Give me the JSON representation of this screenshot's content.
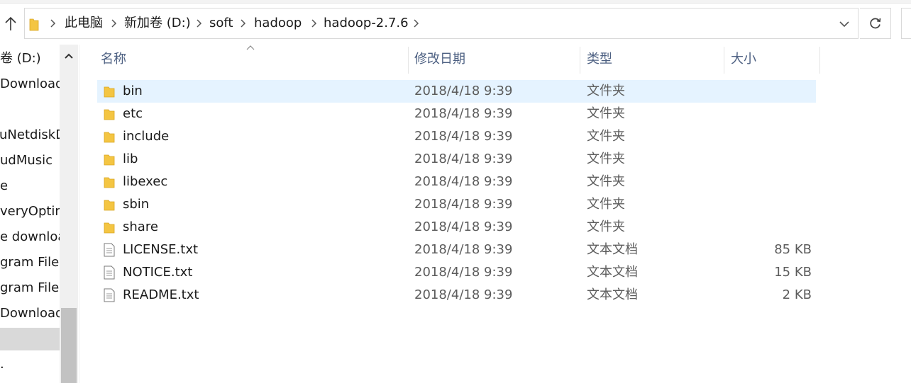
{
  "breadcrumb": [
    "此电脑",
    "新加卷 (D:)",
    "soft",
    "hadoop",
    "hadoop-2.7.6"
  ],
  "nav_items": [
    {
      "label": "卷 (D:)"
    },
    {
      "label": "Download"
    },
    {
      "label": ""
    },
    {
      "label": "luNetdiskD"
    },
    {
      "label": "udMusic"
    },
    {
      "label": "e"
    },
    {
      "label": "veryOptim"
    },
    {
      "label": "e downloa"
    },
    {
      "label": "gram Files"
    },
    {
      "label": "gram Files"
    },
    {
      "label": "Download"
    },
    {
      "label": "",
      "selected": true
    },
    {
      "label": "."
    }
  ],
  "columns": {
    "name": "名称",
    "date": "修改日期",
    "type": "类型",
    "size": "大小"
  },
  "files": [
    {
      "name": "bin",
      "date": "2018/4/18 9:39",
      "type": "文件夹",
      "size": "",
      "icon": "folder-icon",
      "selected": true
    },
    {
      "name": "etc",
      "date": "2018/4/18 9:39",
      "type": "文件夹",
      "size": "",
      "icon": "folder-icon"
    },
    {
      "name": "include",
      "date": "2018/4/18 9:39",
      "type": "文件夹",
      "size": "",
      "icon": "folder-icon"
    },
    {
      "name": "lib",
      "date": "2018/4/18 9:39",
      "type": "文件夹",
      "size": "",
      "icon": "folder-icon"
    },
    {
      "name": "libexec",
      "date": "2018/4/18 9:39",
      "type": "文件夹",
      "size": "",
      "icon": "folder-icon"
    },
    {
      "name": "sbin",
      "date": "2018/4/18 9:39",
      "type": "文件夹",
      "size": "",
      "icon": "folder-icon"
    },
    {
      "name": "share",
      "date": "2018/4/18 9:39",
      "type": "文件夹",
      "size": "",
      "icon": "folder-icon"
    },
    {
      "name": "LICENSE.txt",
      "date": "2018/4/18 9:39",
      "type": "文本文档",
      "size": "85 KB",
      "icon": "text-file-icon"
    },
    {
      "name": "NOTICE.txt",
      "date": "2018/4/18 9:39",
      "type": "文本文档",
      "size": "15 KB",
      "icon": "text-file-icon"
    },
    {
      "name": "README.txt",
      "date": "2018/4/18 9:39",
      "type": "文本文档",
      "size": "2 KB",
      "icon": "text-file-icon"
    }
  ],
  "colors": {
    "selection": "#e5f3ff",
    "header_text": "#4d6082",
    "folder": "#f4c542"
  }
}
